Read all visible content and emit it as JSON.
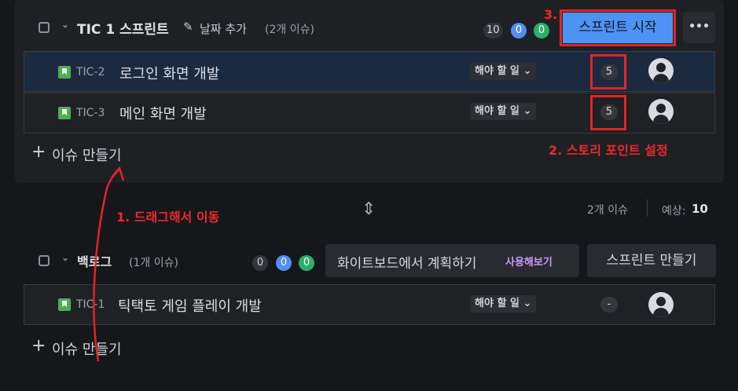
{
  "sprint": {
    "title": "TIC 1 스프린트",
    "add_date": "날짜 추가",
    "issue_count": "(2개 이슈)",
    "counts": {
      "todo": "10",
      "in_progress": "0",
      "done": "0"
    },
    "start_button": "스프린트 시작",
    "more": "•••",
    "issues": [
      {
        "key": "TIC-2",
        "summary": "로그인 화면 개발",
        "status": "해야 할 일",
        "points": "5"
      },
      {
        "key": "TIC-3",
        "summary": "메인 화면 개발",
        "status": "해야 할 일",
        "points": "5"
      }
    ],
    "create_issue": "이슈 만들기",
    "footer_count": "2개 이슈",
    "estimate_label": "예상:",
    "estimate_value": "10"
  },
  "backlog": {
    "title": "백로그",
    "issue_count": "(1개 이슈)",
    "counts": {
      "todo": "0",
      "in_progress": "0",
      "done": "0"
    },
    "whiteboard_button": "화이트보드에서 계획하기",
    "try_label": "사용해보기",
    "create_sprint_button": "스프린트 만들기",
    "issues": [
      {
        "key": "TIC-1",
        "summary": "틱택토 게임 플레이 개발",
        "status": "해야 할 일",
        "points": "-"
      }
    ],
    "create_issue": "이슈 만들기"
  },
  "annotations": {
    "step1": "1. 드래그해서 이동",
    "step2": "2. 스토리 포인트 설정",
    "step3": "3."
  },
  "icons": {
    "resize": "⇕",
    "chevron": "⌄",
    "pencil": "✎",
    "plus": "+"
  },
  "colors": {
    "annotation": "#e02525",
    "primary": "#4d93f4",
    "issue_story": "#4ab04d"
  }
}
